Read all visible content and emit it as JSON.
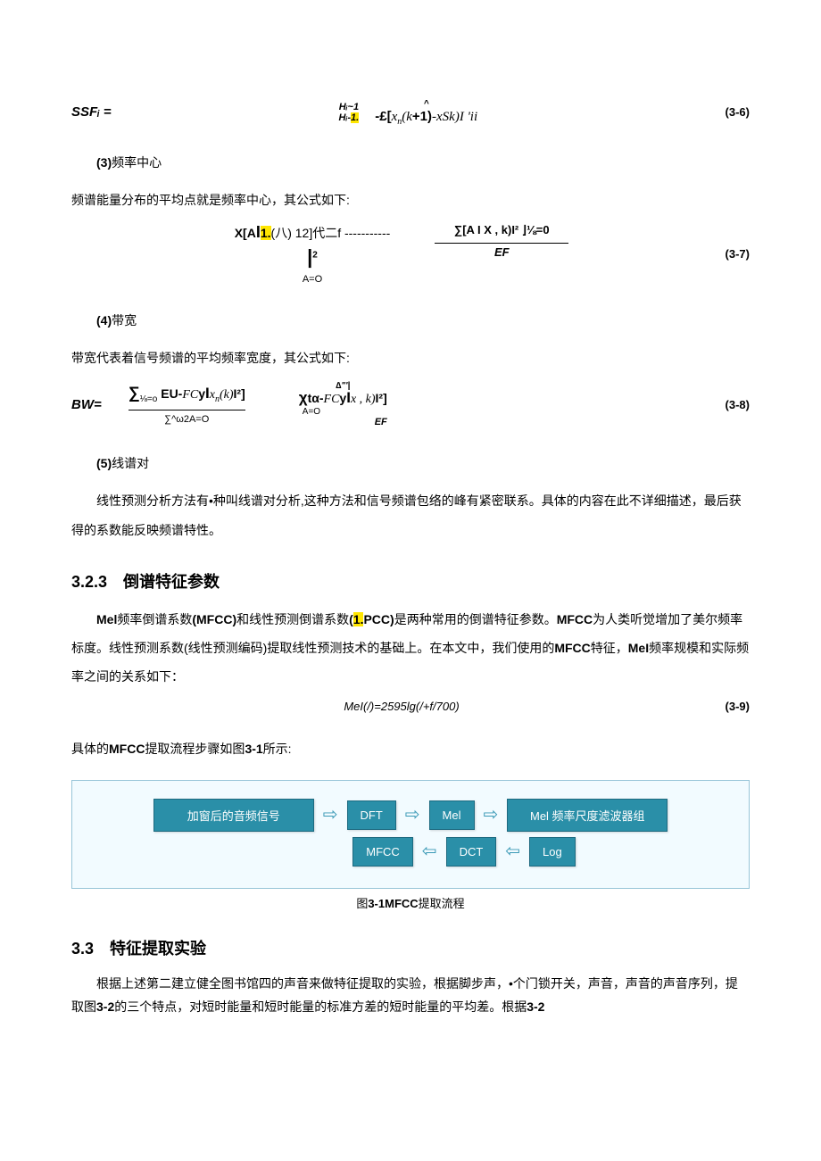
{
  "eq36": {
    "lhs": "SSFᵢ =",
    "frac_top": "Hᵢ~1",
    "frac_bot_pre": "Hᵢ-",
    "frac_bot_hl": "1.",
    "sum_top": "^",
    "main_pre": "-£[",
    "main_x": "x",
    "main_n": "n",
    "main_k": "(k",
    "main_plus": "+1",
    "main_close": ")",
    "main_rest": "-xSk)I 'ii",
    "num": "(3-6)"
  },
  "item3": {
    "head_bold": "(3)",
    "head_rest": "频率中心",
    "para": "频谱能量分布的平均点就是频率中心，其公式如下:"
  },
  "eq37": {
    "left_line1_a": "X[A",
    "left_line1_b": "I",
    "left_line1_hl": "1.",
    "left_line1_c": "(八) 12]代二f -----------",
    "left_line2": "|",
    "left_line2_sup": "2",
    "left_line3": "A=O",
    "right_top": "∑[A I X , k)I² ⌋⅛=0",
    "right_bot": "EF",
    "num": "(3-7)"
  },
  "item4": {
    "head_bold": "(4)",
    "head_rest": "带宽",
    "para": "带宽代表着信号频谱的平均频率宽度，其公式如下:"
  },
  "eq38": {
    "lhs": "BW=",
    "left_top_a": "∑",
    "left_top_sub": "⅛=o",
    "left_top_b": "EU-",
    "left_top_c": "FC",
    "left_top_d": "y",
    "left_top_e": "I",
    "left_top_f": "x",
    "left_top_g": "n",
    "left_top_h": "(k)",
    "left_top_i": "I²",
    "left_top_j": "]",
    "left_bot": "∑^ω2A=O",
    "right_pre": "∆\"'|",
    "right_mid_a": "χ",
    "right_mid_b": "tα-",
    "right_mid_c": "FC",
    "right_mid_d": "y",
    "right_mid_e": "I",
    "right_mid_f": "x , k)",
    "right_mid_g": "I²]",
    "right_sub": "A=O",
    "right_bot": "EF",
    "num": "(3-8)"
  },
  "item5": {
    "head_bold": "(5)",
    "head_rest": "线谱对",
    "para": "线性预测分析方法有•种叫线谱对分析,这种方法和信号频谱包络的峰有紧密联系。具体的内容在此不详细描述，最后获得的系数能反映频谱特性。"
  },
  "sec323": {
    "title": "3.2.3　倒谱特征参数",
    "p1_a": "Mel",
    "p1_b": "频率倒谱系数",
    "p1_c": "(MFCC)",
    "p1_d": "和线性预测倒谱系数",
    "p1_e": "(",
    "p1_hl": "1.",
    "p1_f": "PCC)",
    "p1_g": "是两种常用的倒谱特征参数。",
    "p1_h": "MFCC",
    "p1_i": "为人类听觉增加了美尔频率标度。线性预测系数(线性预测编码)提取线性预测技术的基础上。在本文中，我们使用的",
    "p1_j": "MFCC",
    "p1_k": "特征，",
    "p1_l": "MeI",
    "p1_m": "频率规模和实际频率之间的关系如下：",
    "eq39_body": "MeI(/)=2595lg(/+f/700)",
    "eq39_num": "(3-9)",
    "p2_a": "具体的",
    "p2_b": "MFCC",
    "p2_c": "提取流程步骤如图",
    "p2_d": "3-1",
    "p2_e": "所示:"
  },
  "flow": {
    "b1": "加窗后的音频信号",
    "b2": "DFT",
    "b3": "Mel",
    "b4": "Mel 频率尺度滤波器组",
    "b5": "MFCC",
    "b6": "DCT",
    "b7": "Log"
  },
  "figcap": {
    "a": "图",
    "b": "3-1MFCC",
    "c": "提取流程"
  },
  "sec33": {
    "title": "3.3　特征提取实验",
    "p_a": "根据上述第二建立健全图书馆四的声音来做特征提取的实验，根据脚步声，•个门锁开关，声音，声音的声音序列，提取图",
    "p_b": "3-2",
    "p_c": "的三个特点，对短时能量和短时能量的标准方差的短时能量的平均差。根据",
    "p_d": "3-2"
  }
}
